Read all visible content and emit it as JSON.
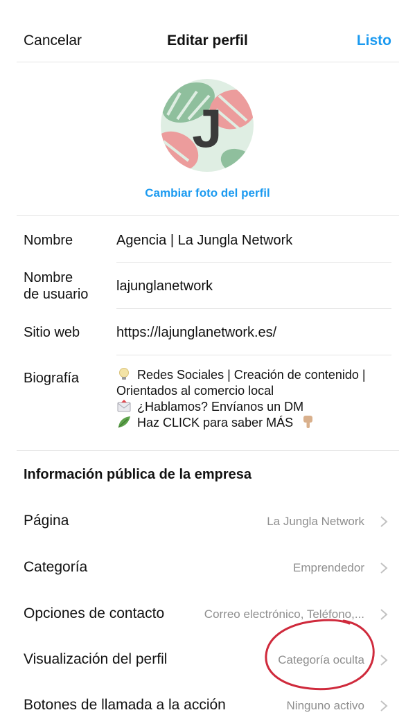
{
  "header": {
    "cancel_label": "Cancelar",
    "title": "Editar perfil",
    "done_label": "Listo"
  },
  "profile_photo": {
    "letter": "J",
    "change_label": "Cambiar foto del perfil"
  },
  "fields": {
    "name": {
      "label": "Nombre",
      "value": "Agencia | La Jungla Network"
    },
    "username": {
      "label_line1": "Nombre",
      "label_line2": "de usuario",
      "value": "lajunglanetwork"
    },
    "website": {
      "label": "Sitio web",
      "value": "https://lajunglanetwork.es/"
    },
    "bio": {
      "label": "Biografía",
      "lines": [
        "Redes Sociales | Creación de contenido |",
        "Orientados al comercio local",
        "¿Hablamos? Envíanos un DM",
        "Haz CLICK para saber MÁS"
      ],
      "icons": [
        "lightbulb-icon",
        "envelope-icon",
        "leaf-icon",
        "pointing-down-hand-icon"
      ]
    }
  },
  "business_info": {
    "title": "Información pública de la empresa",
    "rows": [
      {
        "label": "Página",
        "value": "La Jungla Network"
      },
      {
        "label": "Categoría",
        "value": "Emprendedor"
      },
      {
        "label": "Opciones de contacto",
        "value": "Correo electrónico, Teléfono,..."
      },
      {
        "label": "Visualización del perfil",
        "value": "Categoría oculta"
      },
      {
        "label": "Botones de llamada a la acción",
        "value": "Ninguno activo"
      }
    ]
  },
  "colors": {
    "accent": "#1b9af0",
    "annotation_circle": "#cf2a3c",
    "secondary_text": "#8e8e8e",
    "divider": "#e4e4e4"
  }
}
